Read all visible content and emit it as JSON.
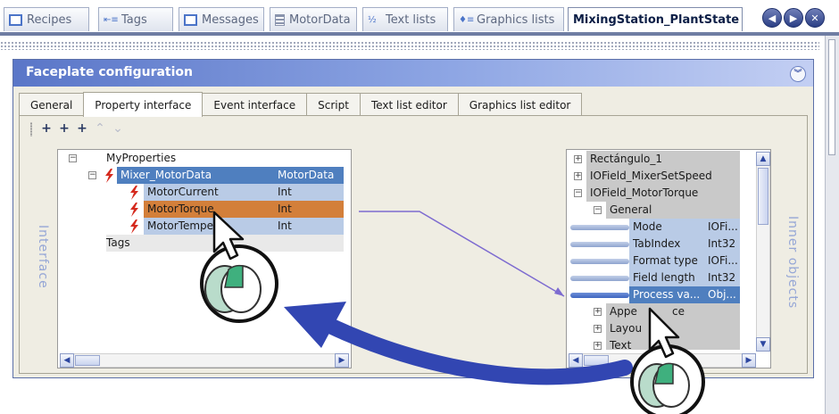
{
  "editor_tabs": [
    {
      "label": "Recipes",
      "icon": "recipes-icon"
    },
    {
      "label": "Tags",
      "icon": "tags-icon"
    },
    {
      "label": "Messages",
      "icon": "messages-icon"
    },
    {
      "label": "MotorData",
      "icon": "motordata-icon"
    },
    {
      "label": "Text lists",
      "icon": "text-lists-icon"
    },
    {
      "label": "Graphics lists",
      "icon": "graphics-lists-icon"
    },
    {
      "label": "MixingStation_PlantState",
      "icon": ""
    }
  ],
  "nav_buttons": {
    "prev": "◀",
    "next": "▶",
    "close": "✕"
  },
  "panel": {
    "title": "Faceplate configuration",
    "collapse_icon": "chevron-double-down-icon"
  },
  "inner_tabs": [
    "General",
    "Property interface",
    "Event interface",
    "Script",
    "Text list editor",
    "Graphics list editor"
  ],
  "toolbar_icons": [
    "add-property-icon",
    "add-child-icon",
    "add-sibling-icon",
    "move-up-icon",
    "move-down-icon"
  ],
  "interface_tree": {
    "label": "Interface",
    "rows": [
      {
        "name": "MyProperties",
        "type": ""
      },
      {
        "name": "Mixer_MotorData",
        "type": "MotorData"
      },
      {
        "name": "MotorCurrent",
        "type": "Int"
      },
      {
        "name": "MotorTorque",
        "type": "Int"
      },
      {
        "name": "MotorTempe",
        "type": "Int"
      },
      {
        "name": "Tags",
        "type": ""
      }
    ]
  },
  "objects_tree": {
    "label": "Inner objects",
    "rows": [
      {
        "name": "Rectángulo_1",
        "type": ""
      },
      {
        "name": "IOField_MixerSetSpeed",
        "type": ""
      },
      {
        "name": "IOField_MotorTorque",
        "type": ""
      },
      {
        "name": "General",
        "type": ""
      },
      {
        "name": "Mode",
        "type": "IOFi..."
      },
      {
        "name": "TabIndex",
        "type": "Int32"
      },
      {
        "name": "Format type",
        "type": "IOFi..."
      },
      {
        "name": "Field length",
        "type": "Int32"
      },
      {
        "name": "Process va...",
        "type": "Obj..."
      },
      {
        "name": "Appe",
        "type": "ce"
      },
      {
        "name": "Layou",
        "type": ""
      },
      {
        "name": "Text",
        "type": ""
      }
    ]
  },
  "colors": {
    "selected_row": "#d37f3a",
    "type_group_row": "#4f7fbf",
    "property_row": "#b9cbe6",
    "gray_row": "#c9c9c9",
    "drag_arrow": "#3246b2",
    "connector_line": "#7d6bd0"
  }
}
